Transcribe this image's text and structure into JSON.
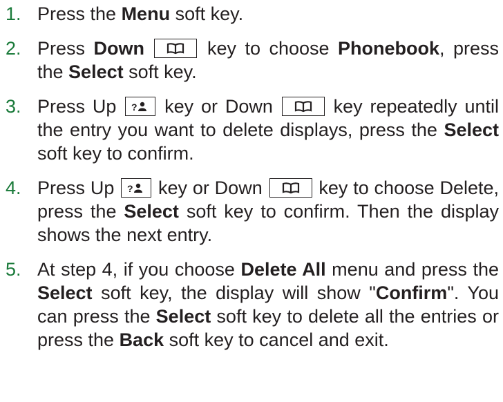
{
  "steps": [
    {
      "num": "1.",
      "t1": "Press the ",
      "b1": "Menu",
      "t2": " soft key."
    },
    {
      "num": "2.",
      "t1": "Press ",
      "b1": "Down",
      "t2": " key to choose ",
      "b2": "Phonebook",
      "t3": ", press the ",
      "b3": "Select",
      "t4": " soft key."
    },
    {
      "num": "3.",
      "t1": "Press Up ",
      "t2": " key or Down ",
      "t3": " key repeatedly until the entry you want to delete displays, press the ",
      "b1": "Select",
      "t4": " soft key to confirm."
    },
    {
      "num": "4.",
      "t1": "Press Up ",
      "t2": " key or Down ",
      "t3": " key to choose Delete, press the ",
      "b1": "Select",
      "t4": " soft key to confirm. Then the display shows the next entry."
    },
    {
      "num": "5.",
      "t1": "At step 4, if you choose ",
      "b1": "Delete All",
      "t2": " menu and press the ",
      "b2": "Select",
      "t3": " soft key, the display will show \"",
      "b3": "Confirm",
      "t4": "\". You can press the ",
      "b4": "Select",
      "t5": " soft key to delete all the entries or press the ",
      "b5": "Back",
      "t6": " soft key to cancel and exit."
    }
  ],
  "icons": {
    "down_key": "phonebook-book-icon",
    "up_key": "contacts-people-icon"
  }
}
